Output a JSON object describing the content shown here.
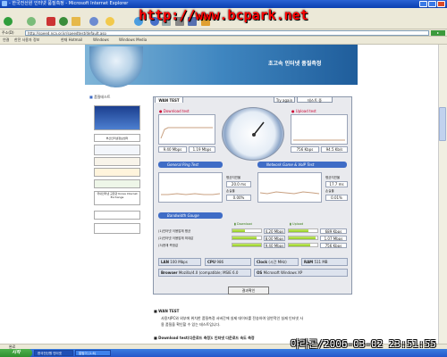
{
  "window": {
    "title": "- 한국전산원 인터넷 품질측정 - Microsoft Internet Explorer"
  },
  "address": {
    "label": "주소(D)",
    "url": "http://speed.nca.or.kr/speedtest/default.asp"
  },
  "links": {
    "label": "연결",
    "items": [
      "한전 사용자 정보",
      "현재 Hotmail",
      "Windows",
      "Windows Media"
    ]
  },
  "banner": {
    "title": "초고속 인터넷 품질측정"
  },
  "sidebar": {
    "title": "품질테스트",
    "items": [
      "",
      "부산인터넷정보센터",
      "",
      "",
      "",
      "",
      "국내인터넷 교환관 Korea Internet Exchange",
      "",
      ""
    ]
  },
  "panel": {
    "tab": "WAN TEST",
    "btn_again": "Try again",
    "btn_test": "테스트 중",
    "download": {
      "label": "Download test",
      "value": "9.40 Mbps",
      "time": "1.19 Mbps",
      "time_label": "시간"
    },
    "upload": {
      "label": "Upload test",
      "value": "756 Kbps",
      "time": "94.5 Kb/s",
      "time_label": "시간"
    },
    "ping_header": "General Ping Test",
    "game_header": "Network Game & VoIP Test",
    "ping": {
      "ms_label": "평균지연율",
      "ms": "20.0 ms",
      "loss_label": "손실율",
      "loss": "0.00%",
      "time_label": "시간"
    },
    "game": {
      "ms_label": "평균지연율",
      "ms": "17.7 ms",
      "loss_label": "손실율",
      "loss": "0.01%",
      "time_label": "시간"
    },
    "bw_header": "Bandwidth Gauge",
    "bw_cols": {
      "download": "Download",
      "upload": "Upload"
    },
    "bw_rows": [
      {
        "label": "(1)인터넷 이용업체 평균",
        "down": "4.20 Mbps",
        "down_frac": 0.45,
        "up": "689 Kbps",
        "up_frac": 0.7
      },
      {
        "label": "(2)인터넷 이용업체 최대값",
        "down": "8.00 Mbps",
        "down_frac": 0.85,
        "up": "1.07 Mbps",
        "up_frac": 0.95
      },
      {
        "label": "(3)현재 측정값",
        "down": "9.40 Mbps",
        "down_frac": 1.0,
        "up": "756 Kbps",
        "up_frac": 0.75
      }
    ],
    "info": {
      "lan_label": "LAN",
      "lan": "100 Mbps",
      "cpu_label": "CPU",
      "cpu": "986",
      "clock_label": "Clock",
      "clock": "(시간 MHz)",
      "ram_label": "RAM",
      "ram": "511 MB",
      "browser_label": "Browser",
      "browser": "Mozilla/4.0 (compatible; MSIE 6.0",
      "os_label": "OS",
      "os": "Microsoft Windows XP"
    },
    "result_btn": "결과확인"
  },
  "desc": {
    "h1": "WAN TEST",
    "p1": "사용자PC와 외부에 위치한 품질측정 서버간에 실제 데이터를 전송하여 일반적인 실제 인터넷 사",
    "p1b": "용 품질을 확인할 수 있는 테스트입니다.",
    "h2": "Download test(다운로드 측정): 인터넷 다운로드 속도 측정"
  },
  "statusbar": {
    "text": "완료"
  },
  "taskbar": {
    "start": "시작",
    "tasks": [
      "한국전산원 인터넷",
      "알림이 (1.6)"
    ]
  },
  "overlay": {
    "watermark": "http://www.bcpark.net",
    "date": "야라곤/2006-03-02 23:51:55"
  },
  "colors": {
    "accent": "#3f6cc6",
    "bar": "#8fc923",
    "chart_line": "#c8a080"
  }
}
